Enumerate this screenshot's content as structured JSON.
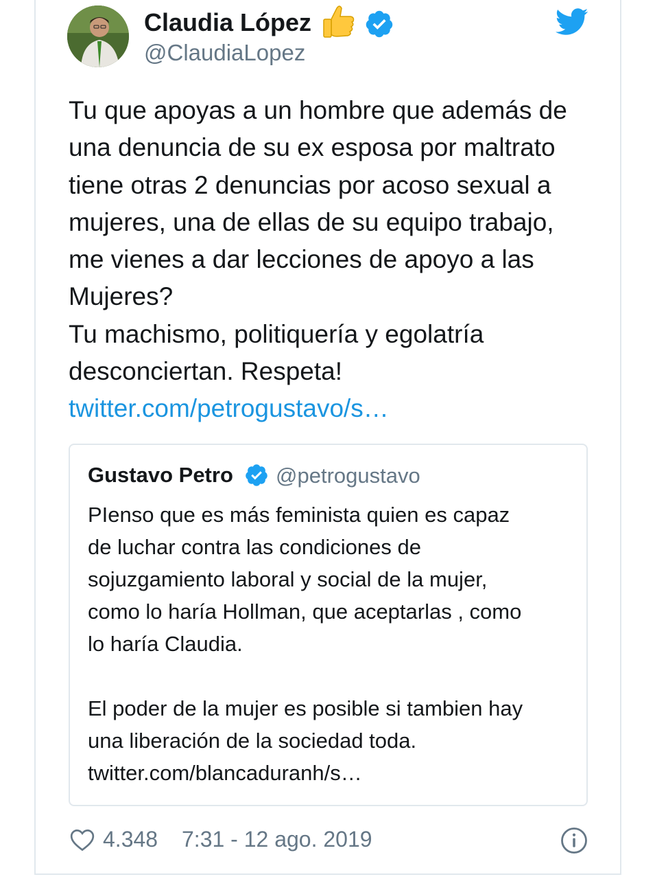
{
  "tweet": {
    "author": {
      "name": "Claudia López",
      "emoji": "👍",
      "handle": "@ClaudiaLopez"
    },
    "text_lines": [
      "Tu que apoyas a un hombre que además de",
      "una denuncia de su ex esposa por maltrato",
      "tiene otras 2 denuncias por acoso sexual a",
      "mujeres, una de ellas de su equipo trabajo,",
      "me vienes a dar lecciones de apoyo a las",
      "Mujeres?",
      "Tu machismo, politiquería y egolatría",
      "desconciertan. Respeta!"
    ],
    "link": "twitter.com/petrogustavo/s…",
    "quoted": {
      "name": "Gustavo Petro",
      "handle": "@petrogustavo",
      "text_lines": [
        "PIenso que es más feminista quien es capaz",
        "de luchar contra las condiciones de",
        "sojuzgamiento laboral y social de la mujer,",
        "como lo haría Hollman, que aceptarlas , como",
        "lo haría Claudia.",
        "",
        "El poder de la mujer es posible si tambien  hay",
        "una liberación de la sociedad toda.",
        "twitter.com/blancaduranh/s…"
      ]
    },
    "likes": "4.348",
    "timestamp": "7:31 - 12 ago. 2019"
  },
  "icons": {
    "verified": "verified-badge-icon",
    "twitter": "twitter-bird-icon",
    "like": "heart-icon",
    "info": "info-icon"
  },
  "colors": {
    "link": "#1b95e0",
    "verified": "#1da1f2",
    "muted": "#657786",
    "text": "#14171a",
    "border": "#e1e8ed"
  }
}
